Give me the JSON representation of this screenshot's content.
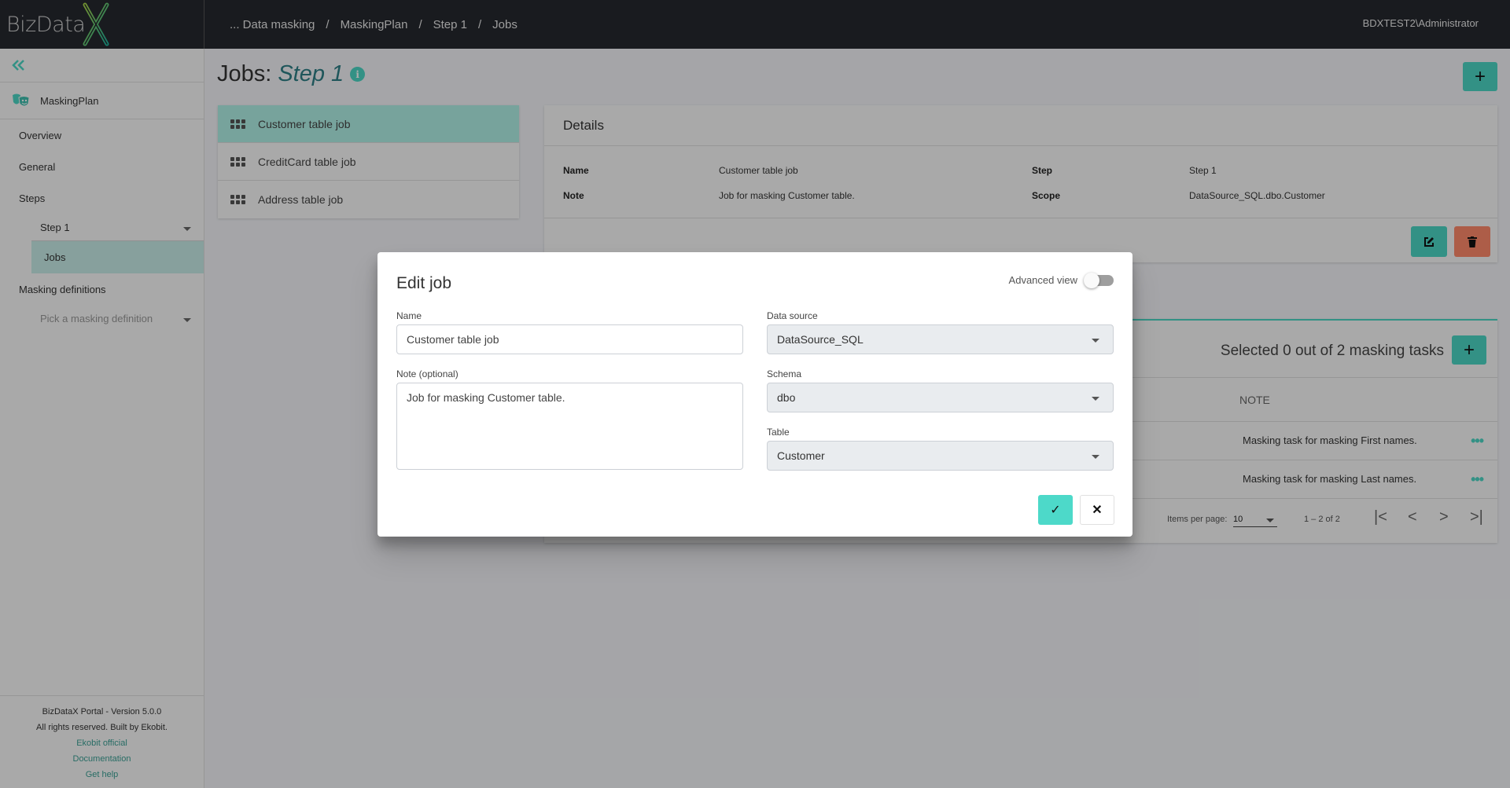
{
  "app": {
    "logo_text": "BizData",
    "logo_mark": "X",
    "user": "BDXTEST2\\Administrator"
  },
  "breadcrumb": [
    {
      "label": "... Data masking"
    },
    {
      "label": "MaskingPlan"
    },
    {
      "label": "Step 1"
    },
    {
      "label": "Jobs"
    }
  ],
  "sidebar": {
    "collapse_icon": "double-chevron-left-icon",
    "plan_icon": "theater-masks-icon",
    "plan_name": "MaskingPlan",
    "items": [
      {
        "label": "Overview"
      },
      {
        "label": "General"
      },
      {
        "label": "Steps"
      },
      {
        "label": "Step 1"
      },
      {
        "label": "Jobs"
      },
      {
        "label": "Masking definitions"
      },
      {
        "label": "Pick a masking definition"
      }
    ],
    "footer": {
      "version": "BizDataX Portal - Version 5.0.0",
      "rights": "All rights reserved. Built by Ekobit.",
      "links": [
        "Ekobit official",
        "Documentation",
        "Get help"
      ]
    }
  },
  "page": {
    "title_prefix": "Jobs:",
    "title_step": "Step 1",
    "info_icon": "i",
    "add_label": "+"
  },
  "jobs": [
    {
      "name": "Customer table job",
      "active": true
    },
    {
      "name": "CreditCard table job",
      "active": false
    },
    {
      "name": "Address table job",
      "active": false
    }
  ],
  "details": {
    "title": "Details",
    "name_label": "Name",
    "name_value": "Customer table job",
    "note_label": "Note",
    "note_value": "Job for masking Customer table.",
    "step_label": "Step",
    "step_value": "Step 1",
    "scope_label": "Scope",
    "scope_value": "DataSource_SQL.dbo.Customer"
  },
  "tasks": {
    "selected_text": "Selected 0 out of 2 masking tasks",
    "add_label": "+",
    "column_note": "NOTE",
    "rows": [
      {
        "note": "Masking task for masking First names.",
        "menu": "•••"
      },
      {
        "note": "Masking task for masking Last names.",
        "menu": "•••"
      }
    ],
    "pager": {
      "items_per_page_label": "Items per page:",
      "items_per_page": "10",
      "range": "1 – 2 of 2",
      "first": "|<",
      "prev": "<",
      "next": ">",
      "last": ">|"
    }
  },
  "modal": {
    "title": "Edit job",
    "advanced_view_label": "Advanced view",
    "advanced_view_on": false,
    "name_label": "Name",
    "name_value": "Customer table job",
    "note_label": "Note (optional)",
    "note_value": "Job for masking Customer table.",
    "datasource_label": "Data source",
    "datasource_value": "DataSource_SQL",
    "schema_label": "Schema",
    "schema_value": "dbo",
    "table_label": "Table",
    "table_value": "Customer",
    "confirm_icon": "✓",
    "cancel_icon": "✕"
  },
  "colors": {
    "accent": "#4cd6c4",
    "danger": "#ff8a6a",
    "header_bg": "#25282e"
  }
}
